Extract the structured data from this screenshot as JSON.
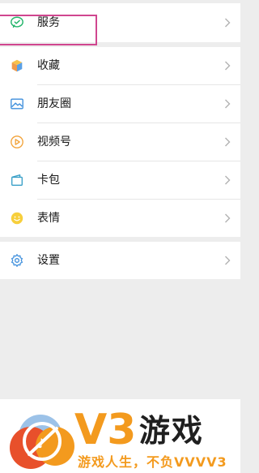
{
  "menu": {
    "service": {
      "label": "服务",
      "icon": "wechat-pay-icon",
      "color": "#22b46a"
    },
    "items": [
      {
        "label": "收藏",
        "icon": "cube-icon"
      },
      {
        "label": "朋友圈",
        "icon": "photo-icon"
      },
      {
        "label": "视频号",
        "icon": "play-circle-icon"
      },
      {
        "label": "卡包",
        "icon": "card-wallet-icon"
      },
      {
        "label": "表情",
        "icon": "smile-icon"
      }
    ],
    "settings": {
      "label": "设置",
      "icon": "gear-icon"
    }
  },
  "watermark": {
    "brand": "V3游戏",
    "tagline": "游戏人生，不负VVVV3",
    "colors": {
      "orange": "#f39a1e",
      "red": "#e8502b",
      "blue": "#2d6cc8"
    }
  }
}
